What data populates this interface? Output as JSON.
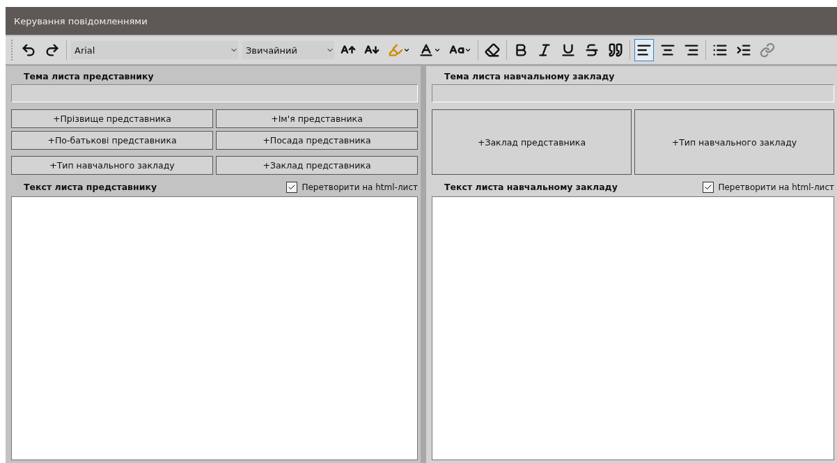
{
  "window": {
    "title": "Керування повідомленнями"
  },
  "toolbar": {
    "font": "Arial",
    "style": "Звичайний",
    "alignments": [
      {
        "selected": true
      },
      {
        "selected": false
      },
      {
        "selected": false
      }
    ]
  },
  "panels": [
    {
      "subject_label": "Тема листа представнику",
      "buttons": [
        "+Прізвище представника",
        "+Ім'я представника",
        "+По-батькові представника",
        "+Посада представника",
        "+Тип навчального закладу",
        "+Заклад представника"
      ],
      "text_label": "Текст листа представнику",
      "html_checkbox": {
        "label": "Перетворити на html-лист",
        "checked": true
      }
    },
    {
      "subject_label": "Тема листа навчальному закладу",
      "buttons": [
        "+Заклад представника",
        "+Тип навчального закладу"
      ],
      "text_label": "Текст листа навчальному закладу",
      "html_checkbox": {
        "label": "Перетворити на html-лист",
        "checked": true
      }
    }
  ]
}
